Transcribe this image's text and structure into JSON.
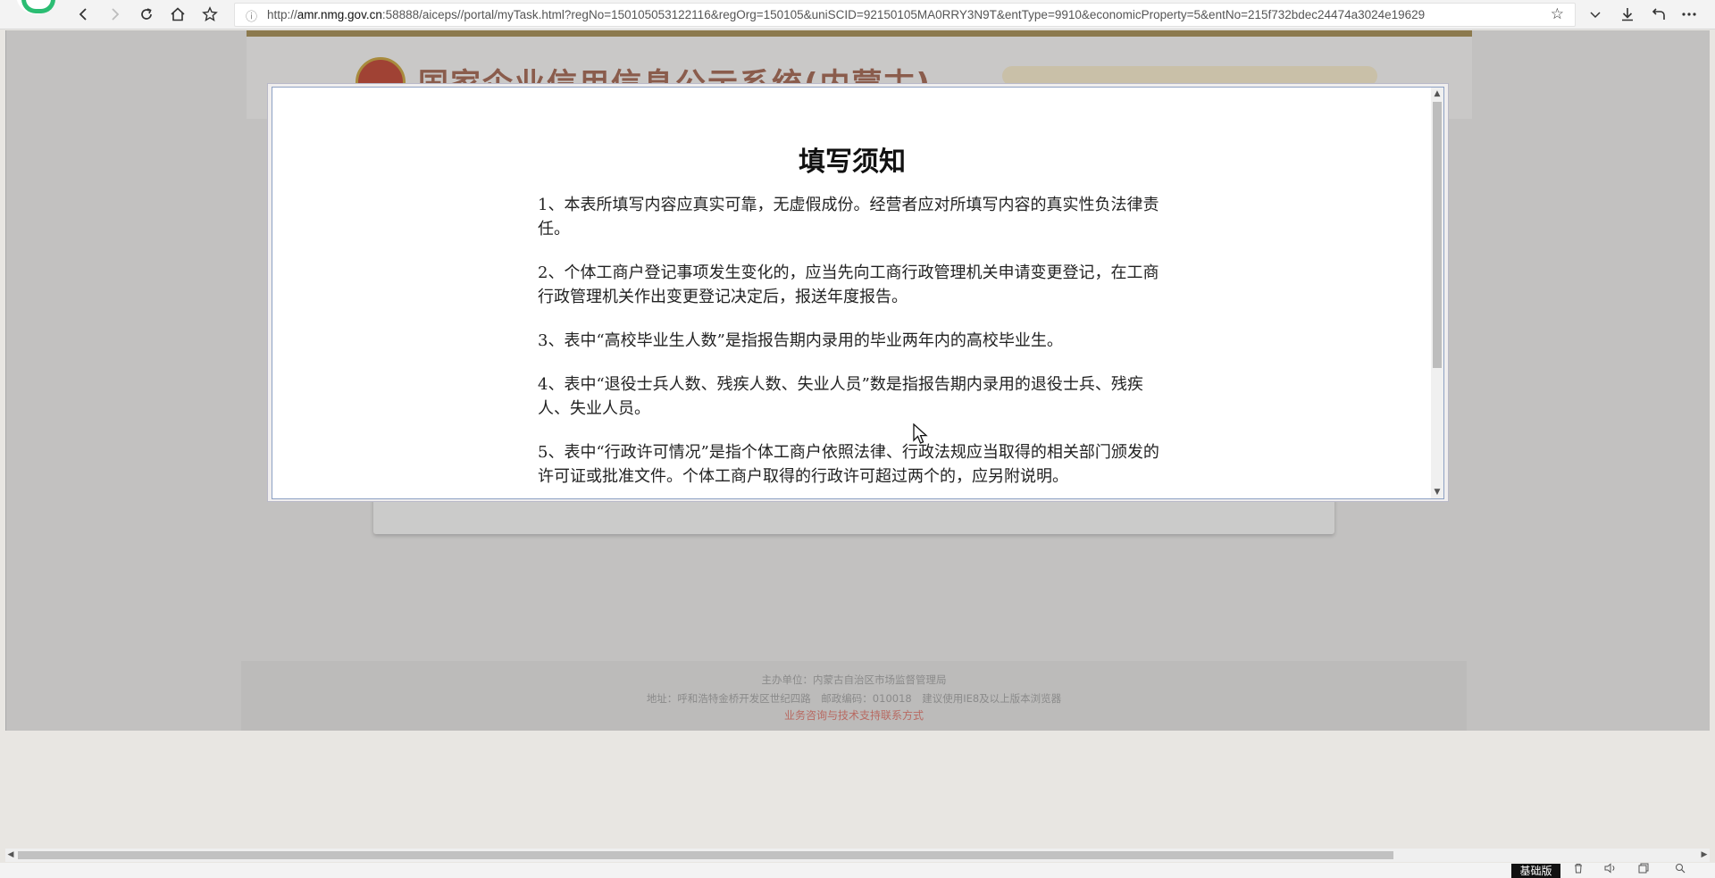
{
  "browser": {
    "url_prefix": "http://",
    "url_host": "amr.nmg.gov.cn",
    "url_rest": ":58888/aiceps//portal/myTask.html?regNo=150105053122116&regOrg=150105&uniSCID=92150105MA0RRY3N9T&entType=9910&economicProperty=5&entNo=215f732bdec24474a3024e19629",
    "icons": [
      "back-icon",
      "forward-icon",
      "refresh-icon",
      "home-icon",
      "star-icon",
      "info-icon",
      "bookmark-star-icon",
      "chevron-down-icon",
      "download-icon",
      "undo-icon",
      "more-icon"
    ]
  },
  "page": {
    "site_title": "国家企业信用信息公示系统(内蒙古)",
    "footer": {
      "line1": "主办单位：内蒙古自治区市场监督管理局",
      "line2": "地址：呼和浩特金桥开发区世纪四路　邮政编码：010018　建议使用IE8及以上版本浏览器",
      "link": "业务咨询与技术支持联系方式"
    },
    "colors": {
      "gold_bar": "#8c7a4e",
      "overlay": "#c2c1c0",
      "link": "#b86a62"
    }
  },
  "modal": {
    "title": "填写须知",
    "items": [
      "1、本表所填写内容应真实可靠，无虚假成份。经营者应对所填写内容的真实性负法律责任。",
      "2、个体工商户登记事项发生变化的，应当先向工商行政管理机关申请变更登记，在工商行政管理机关作出变更登记决定后，报送年度报告。",
      "3、表中“高校毕业生人数”是指报告期内录用的毕业两年内的高校毕业生。",
      "4、表中“退役士兵人数、残疾人数、失业人员”数是指报告期内录用的退役士兵、残疾人、失业人员。",
      "5、表中“行政许可情况”是指个体工商户依照法律、行政法规应当取得的相关部门颁发的许可证或批准文件。个体工商户取得的行政许可超过两个的，应另附说明。"
    ]
  },
  "statusbar": {
    "mode_badge": "基础版"
  }
}
